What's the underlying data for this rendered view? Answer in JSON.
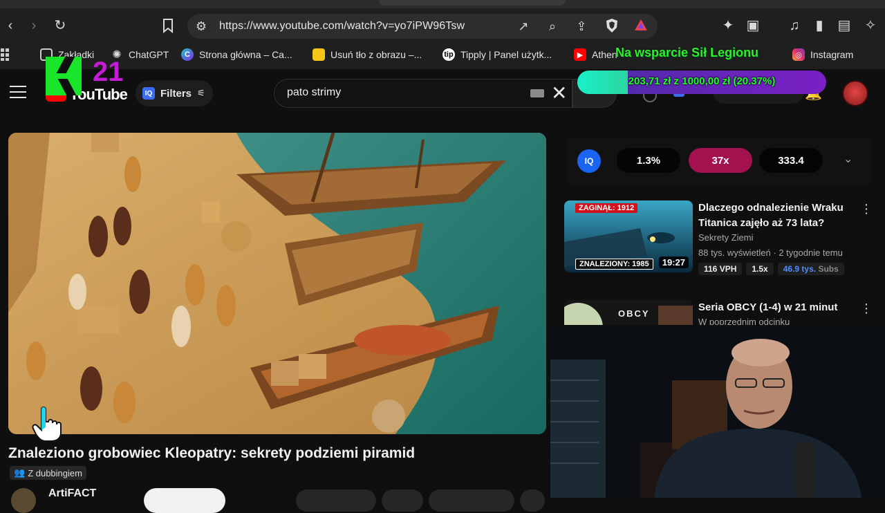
{
  "browser": {
    "url": "https://www.youtube.com/watch?v=yo7iPW96Tsw",
    "bookmarks": [
      {
        "label": "Zakładki",
        "icon": "bookmark-folder-icon"
      },
      {
        "label": "ChatGPT",
        "icon": "chatgpt-icon"
      },
      {
        "label": "Strona główna – Ca...",
        "icon": "canva-icon"
      },
      {
        "label": "Usuń tło z obrazu –...",
        "icon": "removebg-icon"
      },
      {
        "label": "Tipply | Panel użytk...",
        "icon": "tipply-icon"
      },
      {
        "label": "Athen",
        "icon": "youtube-icon"
      },
      {
        "label": "Instagram",
        "icon": "instagram-icon"
      }
    ],
    "bookmark_tip_label": "tip"
  },
  "overlay": {
    "k21_number": "21",
    "donation_title": "Na wsparcie Sił Legionu",
    "donation_text": "203,71 zł z 1000,00 zł (20.37%)",
    "donation_progress": 0.2037
  },
  "masthead": {
    "logo_text": "YouTube",
    "filters_label": "Filters",
    "iq_badge": "IQ",
    "search_value": "pato strimy"
  },
  "video": {
    "title": "Znaleziono grobowiec Kleopatry: sekrety podziemi piramid",
    "dub_label": "Z dubbingiem",
    "channel": "ArtiFACT"
  },
  "stats": {
    "logo": "IQ",
    "pills": [
      "1.3%",
      "37x",
      "333.4"
    ],
    "highlight_color": "#a3114f"
  },
  "recommendations": [
    {
      "title": "Dlaczego odnalezienie Wraku Titanica zajęło aż 73 lata?",
      "channel": "Sekrety Ziemi",
      "meta": "88 tys. wyświetleń · 2 tygodnie temu",
      "duration": "19:27",
      "thumb_top_label": "ZAGINĄŁ: 1912",
      "thumb_bottom_label": "ZNALEZIONY: 1985",
      "badges": {
        "vph": "116 VPH",
        "ratio": "1.5x",
        "subs_value": "46.9 tys.",
        "subs_label": "Subs"
      }
    },
    {
      "title": "Seria OBCY (1-4) w 21 minut",
      "channel": "W poprzednim odcinku",
      "thumb_label": "OBCY"
    }
  ],
  "colors": {
    "yt_red": "#ff0000",
    "donation_green": "#2ef02e",
    "subs_blue": "#4f8cff"
  }
}
